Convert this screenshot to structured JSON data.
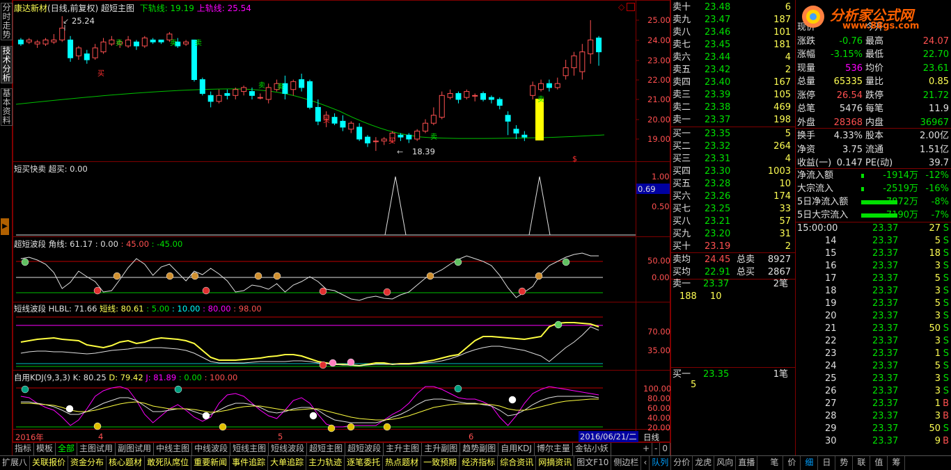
{
  "top": {
    "stock": "康达新材",
    "mode": "(日线,前复权)",
    "indicator": "超短主图",
    "lower_label": "下轨线: 19.19",
    "upper_label": "上轨线: 25.54",
    "high_mark": "25.24",
    "low_mark": "18.39"
  },
  "left_tabs": [
    "分时走势",
    "技术分析",
    "基本资料"
  ],
  "price_axis": [
    "25.00",
    "24.00",
    "23.00",
    "22.00",
    "21.00",
    "20.00",
    "19.00"
  ],
  "panels": {
    "p2": {
      "title": "短买快卖",
      "sub": "超买: 0.00",
      "axis": [
        "1.00",
        "0.50"
      ],
      "cursor": "0.69"
    },
    "p3": {
      "title": "超短波段",
      "sub": "角线: 61.17",
      "v1": ": 0.00",
      "v2": ": 45.00",
      "v3": ": -45.00",
      "axis": [
        "50.00",
        "0.00"
      ]
    },
    "p4": {
      "title": "短线波段",
      "sub": "HLBL: 71.66",
      "v0": "短线: 80.61",
      "v1": ": 5.00",
      "v2": ": 10.00",
      "v3": ": 80.00",
      "v4": ": 98.00",
      "axis": [
        "70.00",
        "35.00"
      ]
    },
    "p5": {
      "title": "自用KDJ(9,3,3)",
      "k": "K: 80.25",
      "d": "D: 79.42",
      "j": "J: 81.89",
      "v1": ": 0.00",
      "v2": ": 100.00",
      "axis": [
        "100.00",
        "80.00",
        "60.00",
        "40.00",
        "20.00"
      ]
    }
  },
  "date_axis": {
    "labels": [
      "2016年",
      "4",
      "5",
      "6"
    ],
    "current": "2016/06/21/二",
    "period": "日线"
  },
  "bottom_tabs": [
    "指标",
    "模板",
    "全部",
    "主图试用",
    "副图试用",
    "中线主图",
    "中线波段",
    "短线主图",
    "短线波段",
    "超短主图",
    "超短波段",
    "主升主图",
    "主升副图",
    "趋势副图",
    "自用KDJ",
    "博尔主量",
    "金钻小妖"
  ],
  "status_items": [
    "扩展八",
    "关联报价",
    "资金分布",
    "核心题材",
    "敢死队席位",
    "重要新闻",
    "事件追踪",
    "大单追踪",
    "主力轨迹",
    "逐笔委托",
    "热点题材",
    "一致预期",
    "经济指标",
    "综合资讯",
    "网摘资讯",
    "图文F10",
    "侧边栏",
    "队列",
    "分价",
    "龙虎",
    "风向",
    "直播",
    "笔",
    "价",
    "细",
    "日",
    "势",
    "联",
    "值",
    "筹"
  ],
  "order_book": {
    "asks": [
      {
        "label": "卖十",
        "price": "23.48",
        "vol": "6"
      },
      {
        "label": "卖九",
        "price": "23.47",
        "vol": "187"
      },
      {
        "label": "卖八",
        "price": "23.46",
        "vol": "101"
      },
      {
        "label": "卖七",
        "price": "23.45",
        "vol": "181"
      },
      {
        "label": "卖六",
        "price": "23.44",
        "vol": "4"
      },
      {
        "label": "卖五",
        "price": "23.42",
        "vol": "2"
      },
      {
        "label": "卖四",
        "price": "23.40",
        "vol": "167"
      },
      {
        "label": "卖三",
        "price": "23.39",
        "vol": "105"
      },
      {
        "label": "卖二",
        "price": "23.38",
        "vol": "469"
      },
      {
        "label": "卖一",
        "price": "23.37",
        "vol": "198"
      }
    ],
    "bids": [
      {
        "label": "买一",
        "price": "23.35",
        "vol": "5"
      },
      {
        "label": "买二",
        "price": "23.32",
        "vol": "264"
      },
      {
        "label": "买三",
        "price": "23.31",
        "vol": "4"
      },
      {
        "label": "买四",
        "price": "23.30",
        "vol": "1003"
      },
      {
        "label": "买五",
        "price": "23.28",
        "vol": "10"
      },
      {
        "label": "买六",
        "price": "23.26",
        "vol": "174"
      },
      {
        "label": "买七",
        "price": "23.25",
        "vol": "33"
      },
      {
        "label": "买八",
        "price": "23.21",
        "vol": "57"
      },
      {
        "label": "买九",
        "price": "23.20",
        "vol": "31"
      },
      {
        "label": "买十",
        "price": "23.19",
        "vol": "2"
      }
    ],
    "avg_sell_label": "卖均",
    "avg_sell": "24.45",
    "total_sell_label": "总卖",
    "total_sell": "8927",
    "avg_buy_label": "买均",
    "avg_buy": "22.91",
    "total_buy_label": "总买",
    "total_buy": "2867",
    "queue1_label": "卖一",
    "queue1_price": "23.37",
    "queue1_count": "2笔",
    "queue1_a": "188",
    "queue1_b": "10",
    "queue2_label": "买一",
    "queue2_price": "23.35",
    "queue2_count": "1笔",
    "queue2_a": "5"
  },
  "stats": [
    {
      "l1": "现价",
      "v1": "",
      "l2": "今开",
      "v2": ""
    },
    {
      "l1": "涨跌",
      "v1": "-0.76",
      "l2": "最高",
      "v2": "24.07"
    },
    {
      "l1": "涨幅",
      "v1": "-3.15%",
      "l2": "最低",
      "v2": "22.70"
    },
    {
      "l1": "现量",
      "v1": "536",
      "l2": "均价",
      "v2": "23.61"
    },
    {
      "l1": "总量",
      "v1": "65335",
      "l2": "量比",
      "v2": "0.85"
    },
    {
      "l1": "涨停",
      "v1": "26.54",
      "l2": "跌停",
      "v2": "21.72"
    },
    {
      "l1": "总笔",
      "v1": "5476",
      "l2": "每笔",
      "v2": "11.9"
    },
    {
      "l1": "外盘",
      "v1": "28368",
      "l2": "内盘",
      "v2": "36967"
    },
    {
      "l1": "换手",
      "v1": "4.33%",
      "l2": "股本",
      "v2": "2.00亿"
    },
    {
      "l1": "净资",
      "v1": "3.75",
      "l2": "流通",
      "v2": "1.51亿"
    },
    {
      "l1": "收益(一)",
      "v1": "0.147",
      "l2": "PE(动)",
      "v2": "39.7"
    }
  ],
  "flows": [
    {
      "label": "净流入额",
      "value": "-1914万",
      "pct": "-12%"
    },
    {
      "label": "大宗流入",
      "value": "-2519万",
      "pct": "-16%"
    },
    {
      "label": "5日净流入额",
      "value": "-7872万",
      "pct": "-8%"
    },
    {
      "label": "5日大宗流入",
      "value": "-7190万",
      "pct": "-7%"
    }
  ],
  "ticks": [
    {
      "t": "15:00:00",
      "p": "23.37",
      "v": "27",
      "d": "S"
    },
    {
      "t": "14",
      "p": "23.37",
      "v": "5",
      "d": "S"
    },
    {
      "t": "15",
      "p": "23.37",
      "v": "18",
      "d": "S"
    },
    {
      "t": "16",
      "p": "23.37",
      "v": "3",
      "d": "S"
    },
    {
      "t": "17",
      "p": "23.37",
      "v": "5",
      "d": "S"
    },
    {
      "t": "18",
      "p": "23.37",
      "v": "3",
      "d": "S"
    },
    {
      "t": "19",
      "p": "23.37",
      "v": "5",
      "d": "S"
    },
    {
      "t": "20",
      "p": "23.37",
      "v": "3",
      "d": "S"
    },
    {
      "t": "21",
      "p": "23.37",
      "v": "50",
      "d": "S"
    },
    {
      "t": "22",
      "p": "23.37",
      "v": "3",
      "d": "S"
    },
    {
      "t": "23",
      "p": "23.37",
      "v": "1",
      "d": "S"
    },
    {
      "t": "24",
      "p": "23.37",
      "v": "5",
      "d": "S"
    },
    {
      "t": "25",
      "p": "23.37",
      "v": "3",
      "d": "S"
    },
    {
      "t": "26",
      "p": "23.37",
      "v": "3",
      "d": "S"
    },
    {
      "t": "27",
      "p": "23.37",
      "v": "1",
      "d": "B"
    },
    {
      "t": "28",
      "p": "23.37",
      "v": "3",
      "d": "B"
    },
    {
      "t": "29",
      "p": "23.37",
      "v": "50",
      "d": "S"
    },
    {
      "t": "30",
      "p": "23.37",
      "v": "9",
      "d": "B"
    }
  ],
  "logo": {
    "text": "分析家公式网",
    "url": "www.88gs.com"
  },
  "colors": {
    "up": "#ff5050",
    "down": "#00ffff",
    "ma": "#00c000",
    "frame": "#800000"
  }
}
